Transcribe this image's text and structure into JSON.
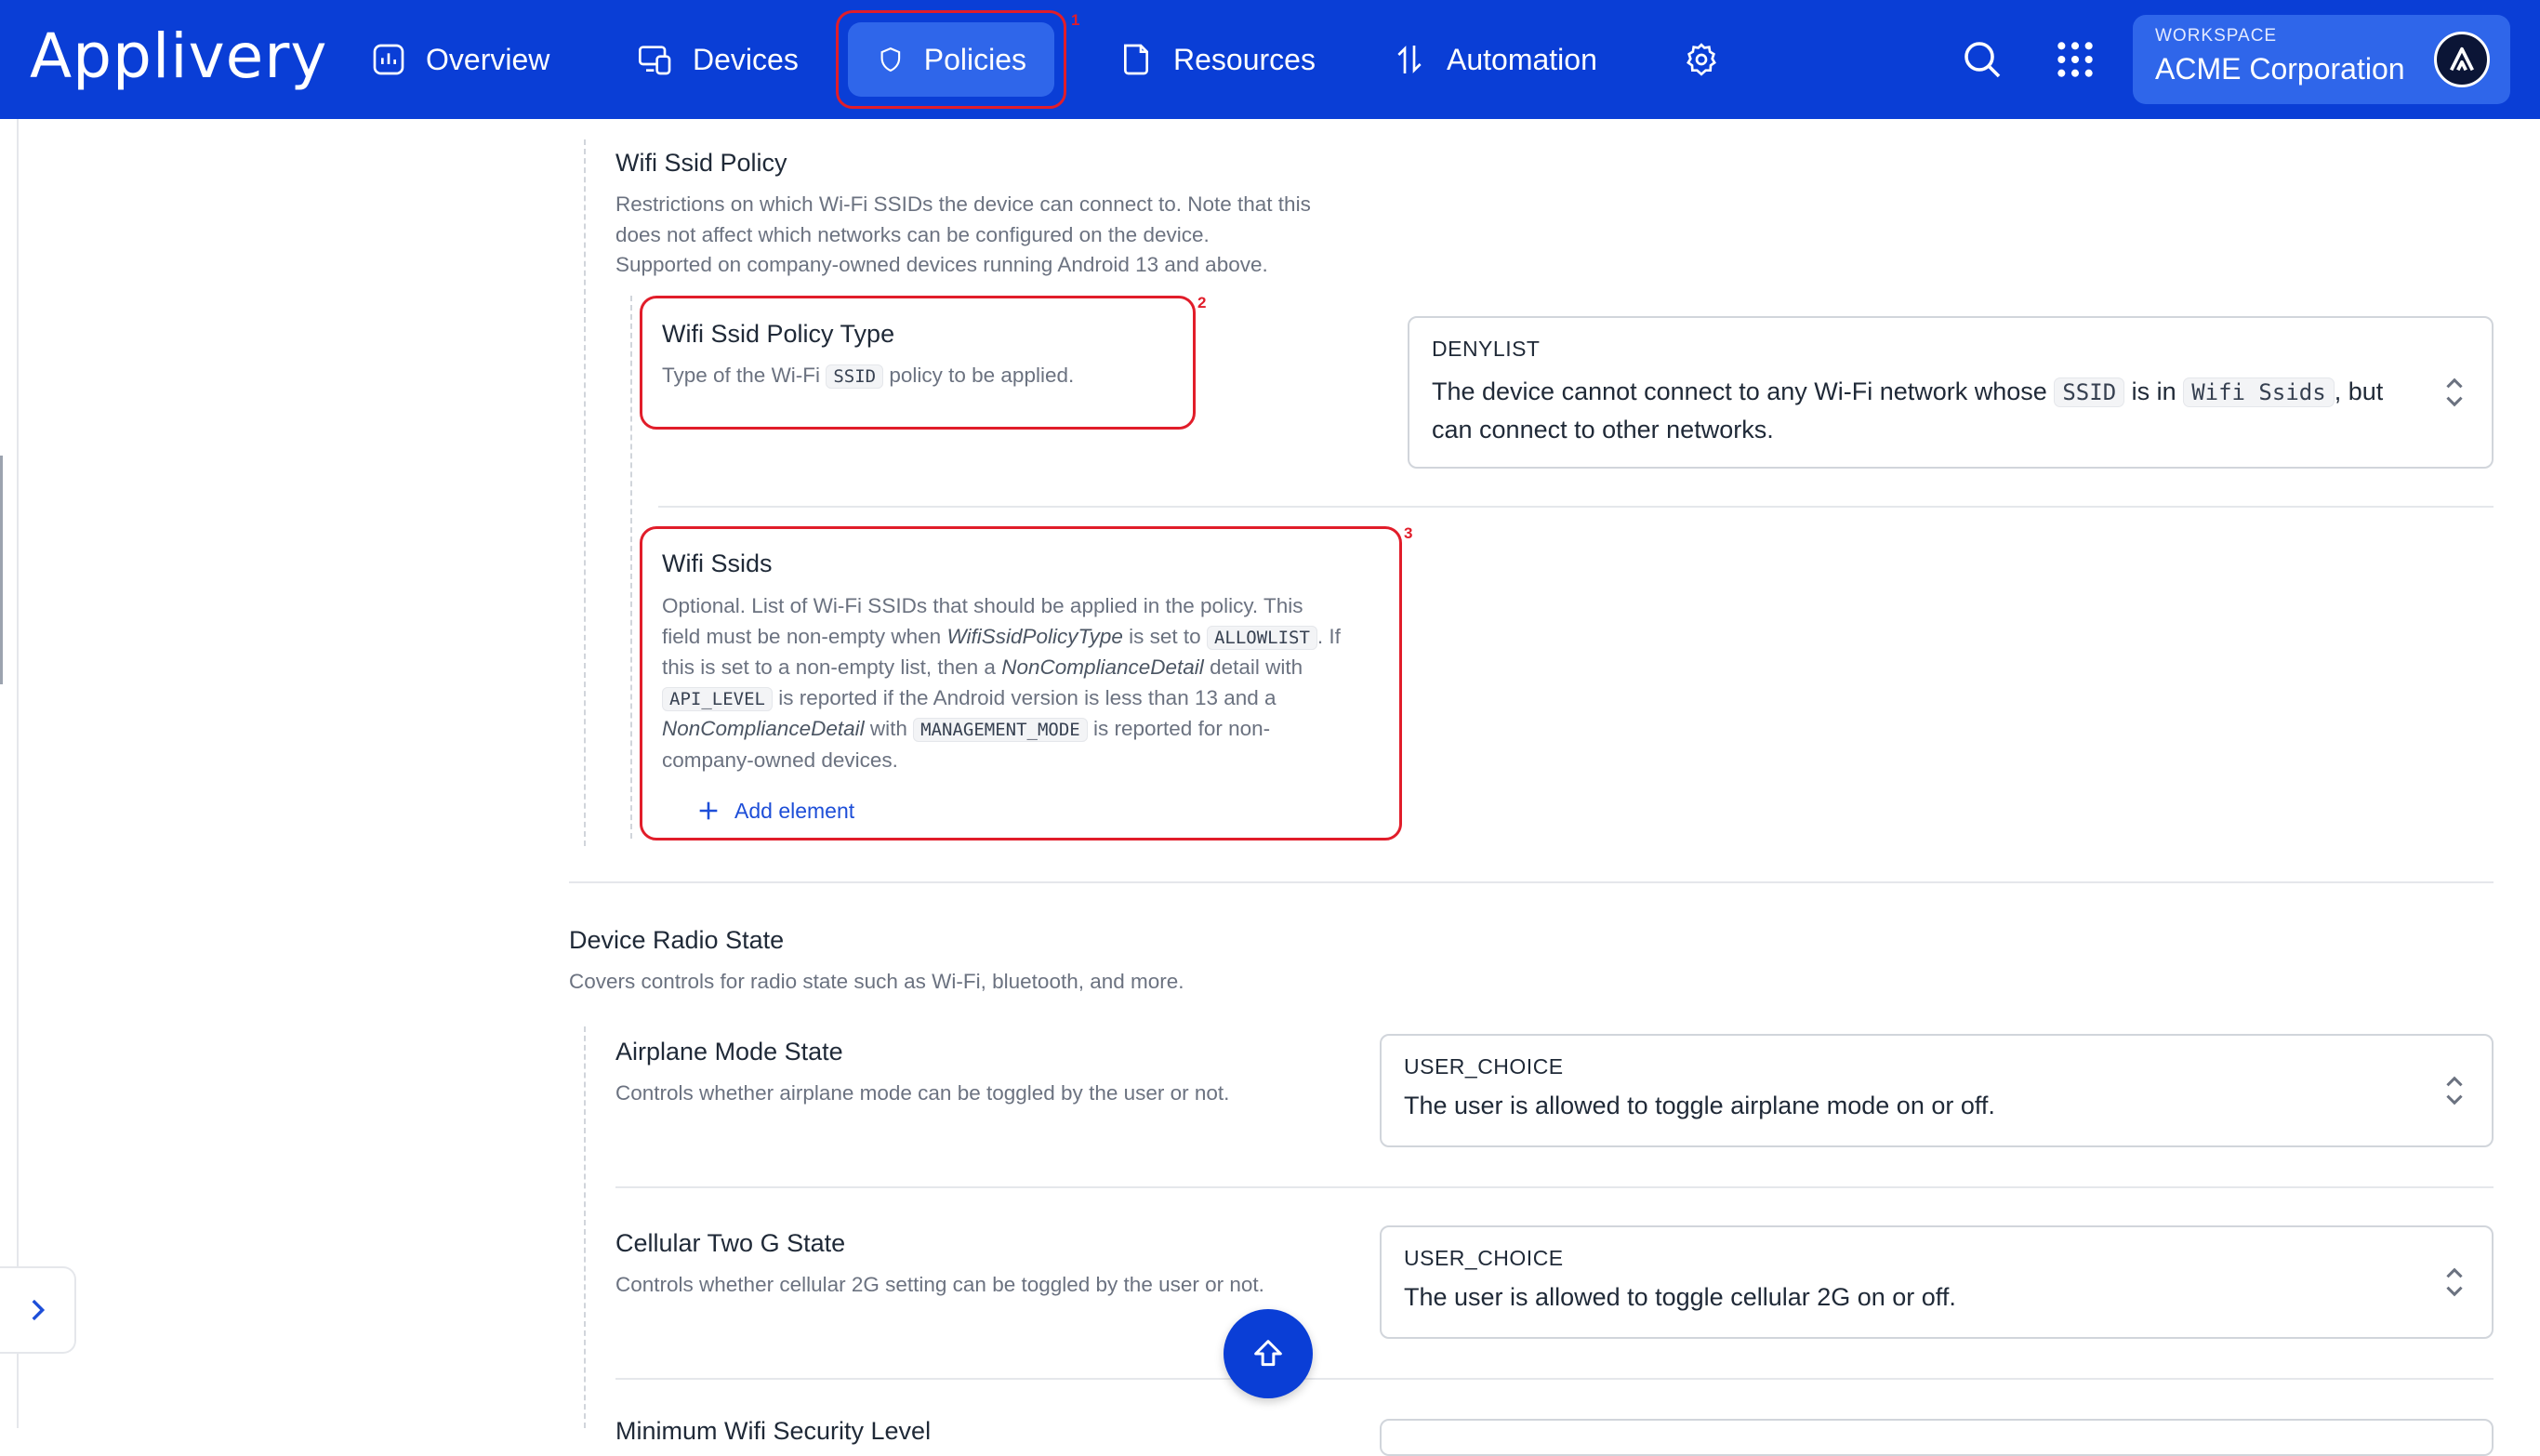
{
  "brand": {
    "logo_text": "Applivery",
    "primary_color": "#0a3ed6",
    "active_tab_color": "#2f66ea",
    "highlight_color": "#e11d2a"
  },
  "nav": {
    "items": [
      {
        "label": "Overview",
        "icon": "bar-chart-icon"
      },
      {
        "label": "Devices",
        "icon": "devices-icon"
      },
      {
        "label": "Policies",
        "icon": "shield-icon",
        "active": true
      },
      {
        "label": "Resources",
        "icon": "folder-icon"
      },
      {
        "label": "Automation",
        "icon": "automation-icon"
      },
      {
        "label": "",
        "icon": "gear-icon"
      }
    ],
    "search_icon": "search-icon",
    "apps_icon": "grid-icon"
  },
  "workspace": {
    "label": "WORKSPACE",
    "name": "ACME Corporation",
    "avatar_icon": "a-logo-icon"
  },
  "annotations": [
    "1",
    "2",
    "3"
  ],
  "wifi_ssid_policy": {
    "title": "Wifi Ssid Policy",
    "description": [
      "Restrictions on which Wi-Fi SSIDs the device can connect to. Note that this",
      "does not affect which networks can be configured on the device.",
      "Supported on company-owned devices running Android 13 and above."
    ],
    "type_field": {
      "title": "Wifi Ssid Policy Type",
      "desc_before": "Type of the Wi-Fi",
      "desc_code": "SSID",
      "desc_after": "policy to be applied.",
      "selected_label": "DENYLIST",
      "selected_desc_1": "The device cannot connect to any Wi-Fi network whose",
      "selected_code_1": "SSID",
      "selected_desc_2": "is in",
      "selected_code_2": "Wifi Ssids",
      "selected_desc_3": ", but",
      "selected_desc_4": "can connect to other networks."
    },
    "ssids_field": {
      "title": "Wifi Ssids",
      "l1": "Optional. List of Wi-Fi SSIDs that should be applied in the policy. This",
      "l2a": "field must be non-empty when",
      "l2em": "WifiSsidPolicyType",
      "l2b": "is set to",
      "l2code": "ALLOWLIST",
      "l2c": ". If",
      "l3a": "this is set to a non-empty list, then a",
      "l3em": "NonComplianceDetail",
      "l3b": "detail with",
      "l4code": "API_LEVEL",
      "l4a": "is reported if the Android version is less than 13 and a",
      "l5em": "NonComplianceDetail",
      "l5a": "with",
      "l5code": "MANAGEMENT_MODE",
      "l5b": "is reported for non-",
      "l6": "company-owned devices.",
      "add_label": "Add element"
    }
  },
  "device_radio_state": {
    "title": "Device Radio State",
    "description": "Covers controls for radio state such as Wi-Fi, bluetooth, and more.",
    "airplane": {
      "title": "Airplane Mode State",
      "description": "Controls whether airplane mode can be toggled by the user or not.",
      "selected_label": "USER_CHOICE",
      "selected_desc": "The user is allowed to toggle airplane mode on or off."
    },
    "cellular": {
      "title": "Cellular Two G State",
      "description": "Controls whether cellular 2G setting can be toggled by the user or not.",
      "selected_label": "USER_CHOICE",
      "selected_desc": "The user is allowed to toggle cellular 2G on or off."
    },
    "next_partial_title": "Minimum Wifi Security Level"
  }
}
